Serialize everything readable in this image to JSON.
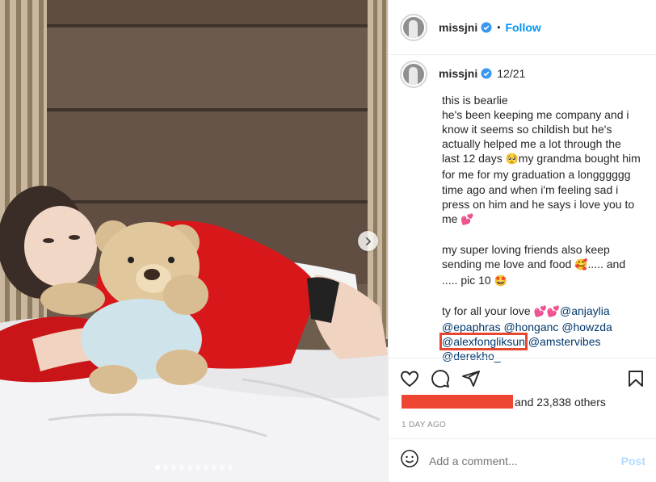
{
  "header": {
    "username": "missjni",
    "separator": "•",
    "follow_label": "Follow"
  },
  "caption": {
    "username": "missjni",
    "time": "12/21",
    "lines": [
      "this is bearlie",
      "he's been keeping me company and i",
      "know it seems so childish but he's",
      "actually helped me a lot through the",
      "last 12 days",
      "my grandma bought him",
      "for me for my graduation a longggggg",
      "time ago and when i'm feeling sad i",
      "press on him and he says i love you to",
      "me",
      "my super loving friends also keep",
      "sending me love and food",
      "..... and",
      "..... pic 10",
      "ty for all your love"
    ],
    "mentions": [
      "@anjaylia",
      "@epaphras",
      "@honganc",
      "@howzda",
      "@alexfongliksun",
      "@amstervibes",
      "@derekho_"
    ],
    "emojis": {
      "tear": "🥺",
      "hearts": "💕",
      "love_face": "🥰",
      "smile": "🤩",
      "hearts_double": "💕💕"
    }
  },
  "actions": {
    "like_icon": "heart-icon",
    "comment_icon": "comment-icon",
    "share_icon": "share-icon",
    "save_icon": "bookmark-icon"
  },
  "likes": {
    "text": "and 23,838 others"
  },
  "timestamp": "1 DAY AGO",
  "comment": {
    "placeholder": "Add a comment...",
    "post_label": "Post"
  },
  "carousel": {
    "total": 10,
    "current": 1
  },
  "colors": {
    "link_blue": "#0095f6",
    "mention": "#00376b",
    "highlight_red": "#e8472f",
    "post_disabled": "#b3dbff",
    "verified": "#3897f0"
  }
}
